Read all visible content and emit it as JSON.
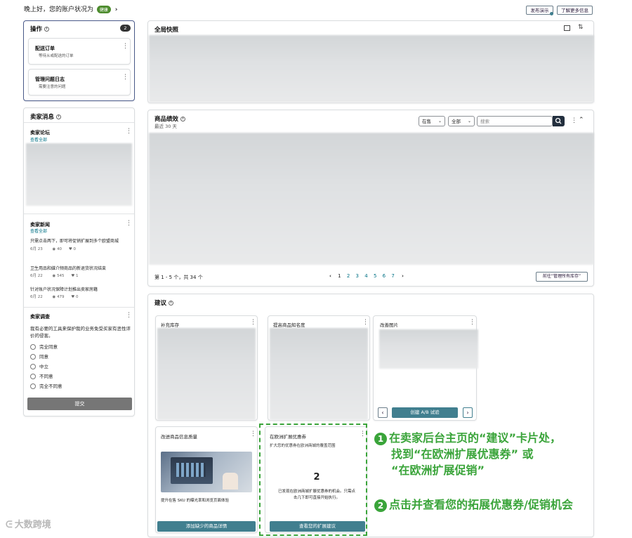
{
  "header": {
    "greeting": "晚上好，您的账户状况为",
    "status_badge": "健康",
    "arrow": "›",
    "btn_demo": "发布演示",
    "btn_learn_more": "了解更多信息"
  },
  "actions_card": {
    "title": "操作",
    "count": "2",
    "items": [
      {
        "title": "配送订单",
        "sub": "等待从或配送的订单"
      },
      {
        "title": "管理问题日志",
        "sub": "需要注意的问题"
      }
    ]
  },
  "seller_news": {
    "title": "卖家消息",
    "forum": {
      "title": "卖家论坛",
      "link": "查看全部"
    },
    "news": {
      "title": "卖家新闻",
      "link": "查看全部",
      "items": [
        {
          "title": "只需点击两下，即可将促销扩展到多个欧盟商城",
          "date": "6月 23",
          "views": "40",
          "likes": "0"
        },
        {
          "title": "卫生用品和媒介频商品的新退货状况结束",
          "date": "6月 22",
          "views": "545",
          "likes": "1"
        },
        {
          "title": "针对账户状况保障计划推出卖家房籍",
          "date": "6月 22",
          "views": "479",
          "likes": "0"
        }
      ]
    },
    "survey": {
      "title": "卖家调查",
      "question": "我有必要的工具来保护我的业务免受买家有恶性评价的侵害。",
      "options": [
        "完全同意",
        "同意",
        "中立",
        "不同意",
        "完全不同意"
      ],
      "submit": "提交"
    }
  },
  "global_snapshot": {
    "title": "全局快照"
  },
  "product_perf": {
    "title": "商品绩效",
    "sub": "最近 30 天",
    "filter_status": "在售",
    "filter_all": "全部",
    "search_placeholder": "搜索",
    "pagination_text": "第 1 - 5 个，共 34 个",
    "pages": [
      "1",
      "2",
      "3",
      "4",
      "5",
      "6",
      "7"
    ],
    "prev": "‹",
    "next": "›",
    "manage_btn": "前往“管理所有库存”"
  },
  "suggestions": {
    "title": "建议",
    "cards": [
      {
        "title": "补充库存"
      },
      {
        "title": "提高商品知名度"
      },
      {
        "title": "改善图片",
        "button": "创建 A/B 试验",
        "prev": "‹",
        "next": "›"
      },
      {
        "title": "改进商品信息质量",
        "body": "提升在售 SKU 的曝光率和浏览页面体验",
        "button": "添加缺少的商品详情"
      },
      {
        "title": "在欧洲扩展优惠券",
        "sub": "扩大您的优惠券在欧洲商城的覆盖范围",
        "number": "2",
        "body": "已发现在欧洲商城扩展优惠券的机会。只需点击几下即可直接开始执行。",
        "button": "查看您的扩展建议"
      }
    ]
  },
  "annotations": {
    "step1_num": "1",
    "step1_line1": "在卖家后台主页的“建议”卡片处，",
    "step1_line2": "找到“在欧洲扩展优惠券” 或",
    "step1_line3": "“在欧洲扩展促销”",
    "step2_num": "2",
    "step2_text": "点击并查看您的拓展优惠券/促销机会"
  },
  "watermark": {
    "text": "大数跨境"
  },
  "colors": {
    "accent": "#417f8f",
    "link": "#007185",
    "annotation": "#3aa43a",
    "badge": "#4d8c2e"
  }
}
